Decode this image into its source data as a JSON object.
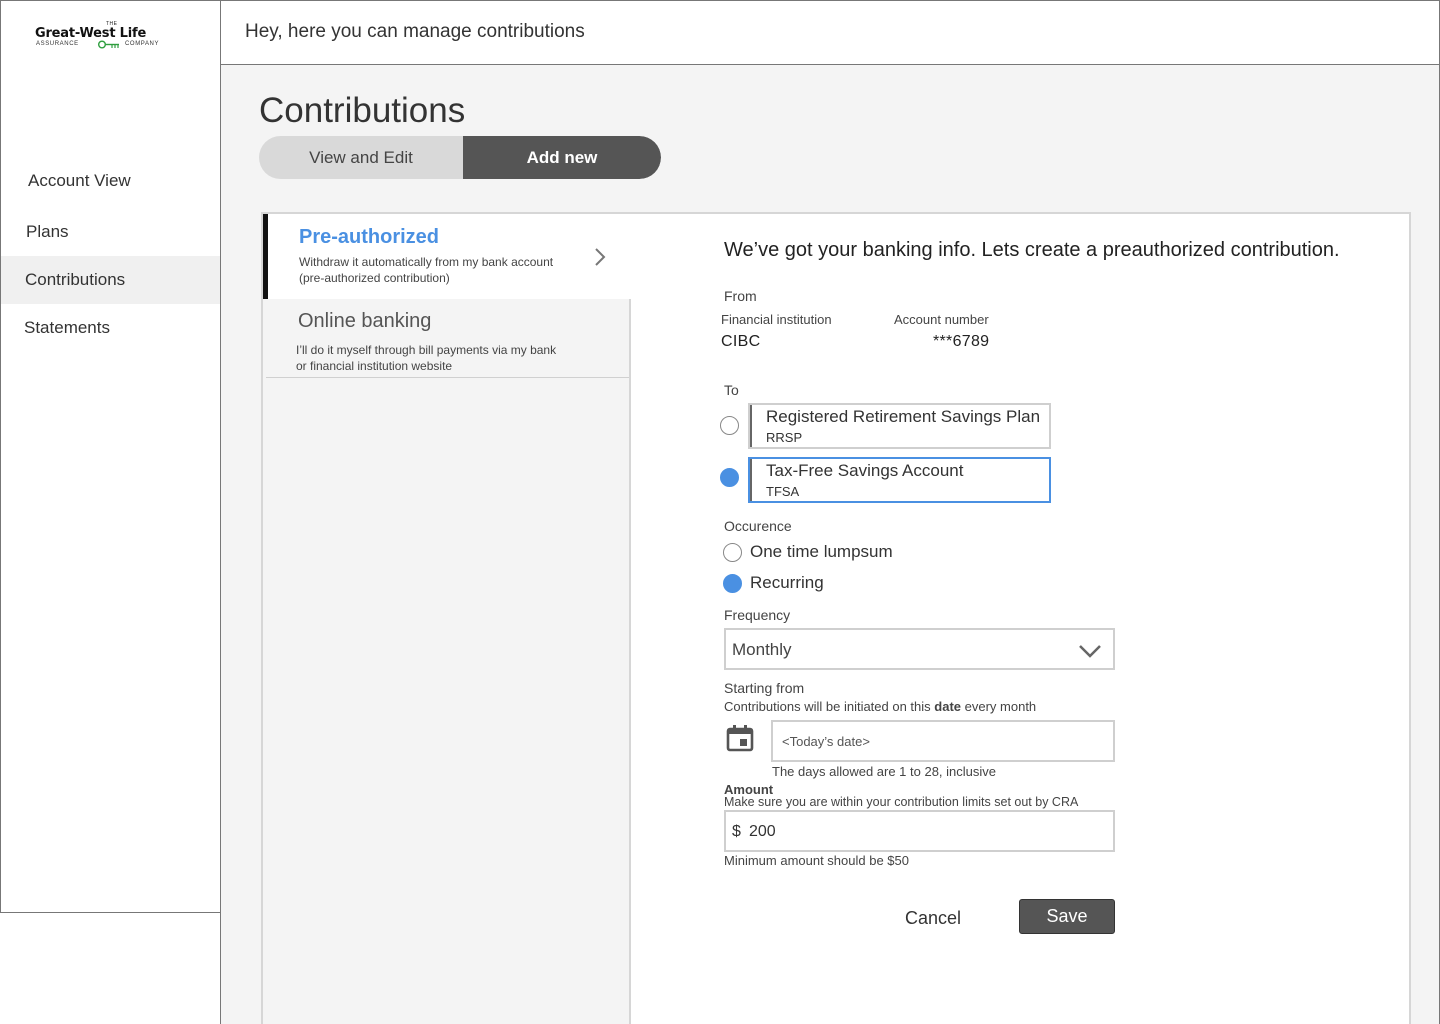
{
  "brand": {
    "logo_the": "THE",
    "logo_main": "Great-West Life",
    "logo_sub_left": "ASSURANCE",
    "logo_sub_right": "COMPANY",
    "accent_color": "#4a90e2",
    "logo_key_color": "#2e9e3e"
  },
  "header": {
    "greeting": "Hey, here you can manage contributions"
  },
  "sidebar": {
    "items": [
      {
        "label": "Account View",
        "active": false
      },
      {
        "label": "Plans",
        "active": false
      },
      {
        "label": "Contributions",
        "active": true
      },
      {
        "label": "Statements",
        "active": false
      }
    ]
  },
  "page": {
    "title": "Contributions",
    "tabs": [
      {
        "label": "View and Edit",
        "selected": false
      },
      {
        "label": "Add new",
        "selected": true
      }
    ]
  },
  "methods": [
    {
      "title": "Pre-authorized",
      "description": "Withdraw it automatically from my bank account (pre-authorized contribution)",
      "selected": true
    },
    {
      "title": "Online banking",
      "description": "I’ll do it myself through bill payments via my bank or financial institution website",
      "selected": false
    }
  ],
  "form": {
    "headline": "We’ve got your banking info. Lets create a preauthorized contribution.",
    "from": {
      "label": "From",
      "institution_label": "Financial institution",
      "institution_value": "CIBC",
      "account_label": "Account number",
      "account_value": "***6789"
    },
    "to": {
      "label": "To",
      "accounts": [
        {
          "name": "Registered Retirement Savings Plan",
          "code": "RRSP",
          "selected": false
        },
        {
          "name": "Tax-Free Savings Account",
          "code": "TFSA",
          "selected": true
        }
      ]
    },
    "occurrence": {
      "label": "Occurence",
      "options": [
        {
          "label": "One time lumpsum",
          "selected": false
        },
        {
          "label": "Recurring",
          "selected": true
        }
      ]
    },
    "frequency": {
      "label": "Frequency",
      "value": "Monthly"
    },
    "starting": {
      "label": "Starting from",
      "help_before": "Contributions will be initiated on this ",
      "help_bold": "date",
      "help_after": " every month",
      "placeholder": "<Today’s date>",
      "note": "The days allowed are 1 to 28, inclusive"
    },
    "amount": {
      "label": "Amount",
      "help": "Make sure you are within your contribution limits set out by CRA",
      "currency": "$",
      "value": "200",
      "note": "Minimum amount should be $50"
    },
    "cancel_label": "Cancel",
    "save_label": "Save"
  }
}
